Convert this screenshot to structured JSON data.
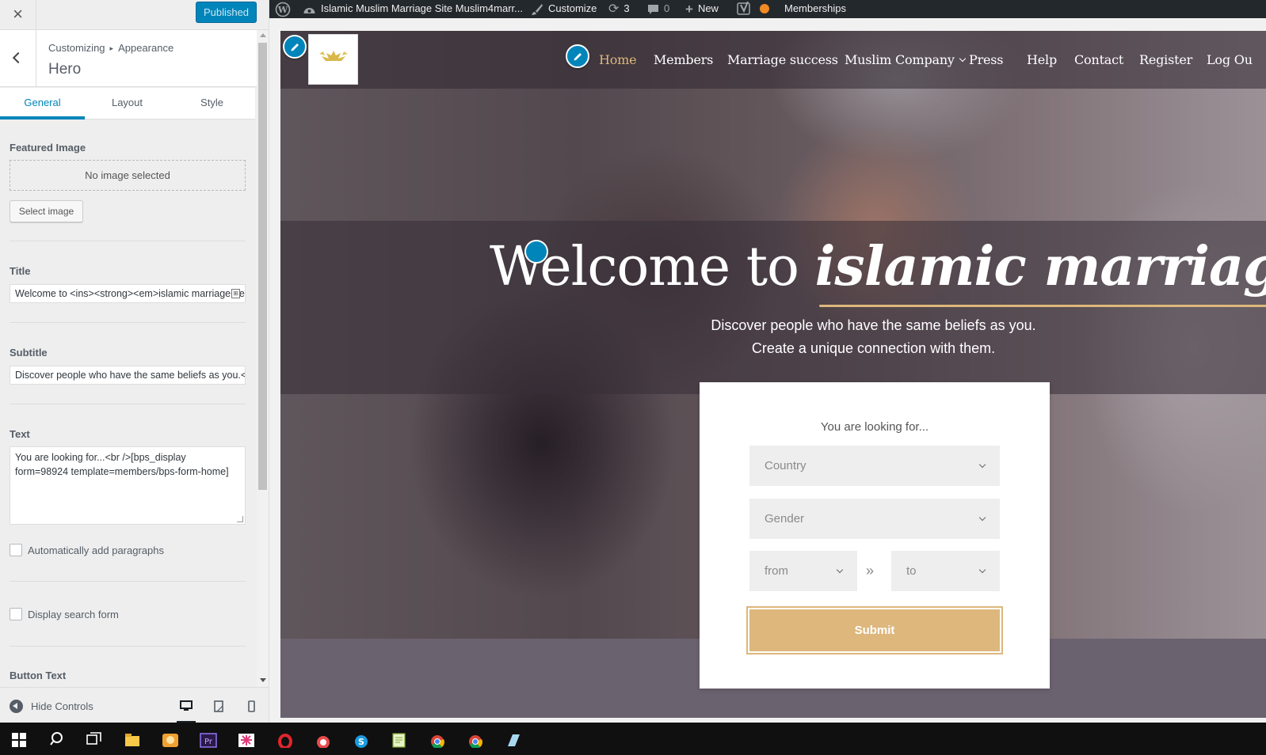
{
  "sidebar": {
    "close_icon": "close-icon",
    "published_label": "Published",
    "breadcrumb": {
      "prefix": "Customizing",
      "section": "Appearance"
    },
    "section_title": "Hero",
    "tabs": [
      {
        "label": "General",
        "active": true
      },
      {
        "label": "Layout",
        "active": false
      },
      {
        "label": "Style",
        "active": false
      }
    ],
    "featured_image": {
      "label": "Featured Image",
      "empty_text": "No image selected",
      "button_label": "Select image"
    },
    "title_field": {
      "label": "Title",
      "value": "Welcome to <ins><strong><em>islamic marriage</em></strong></ins>"
    },
    "subtitle_field": {
      "label": "Subtitle",
      "value": "Discover people who have the same beliefs as you.<br/>Create a unique connection with them."
    },
    "text_field": {
      "label": "Text",
      "value": "You are looking for...<br />[bps_display form=98924 template=members/bps-form-home]"
    },
    "auto_paragraphs": {
      "label": "Automatically add paragraphs",
      "checked": false
    },
    "display_search": {
      "label": "Display search form",
      "checked": false
    },
    "button_text_label": "Button Text",
    "footer": {
      "hide_controls_label": "Hide Controls",
      "devices": [
        "desktop-icon",
        "tablet-icon",
        "mobile-icon"
      ],
      "active_device": "desktop"
    }
  },
  "admin_bar": {
    "site_name": "Islamic Muslim Marriage Site Muslim4marr...",
    "customize_label": "Customize",
    "updates_count": "3",
    "comments_count": "0",
    "new_label": "New",
    "memberships_label": "Memberships",
    "notification_dot_color": "#f08a24"
  },
  "site": {
    "nav": [
      {
        "label": "Home",
        "current": true
      },
      {
        "label": "Members"
      },
      {
        "label": "Marriage success"
      },
      {
        "label": "Muslim Company",
        "dropdown": true
      },
      {
        "label": "Press"
      },
      {
        "label": "Help"
      },
      {
        "label": "Contact"
      },
      {
        "label": "Register"
      },
      {
        "label": "Log Ou"
      }
    ],
    "hero": {
      "title_plain": "Welcome to",
      "title_emphasis": "islamic marriage",
      "subtitle_line1": "Discover people who have the same beliefs as you.",
      "subtitle_line2": "Create a unique connection with them."
    },
    "search_form": {
      "heading": "You are looking for...",
      "country_placeholder": "Country",
      "gender_placeholder": "Gender",
      "age_from_placeholder": "from",
      "range_separator": "»",
      "age_to_placeholder": "to",
      "submit_label": "Submit"
    },
    "accent_color": "#ddb77c"
  },
  "colors": {
    "customizer_primary": "#0085ba",
    "admin_bar_bg": "#23282d",
    "taskbar_bg": "#101010"
  }
}
